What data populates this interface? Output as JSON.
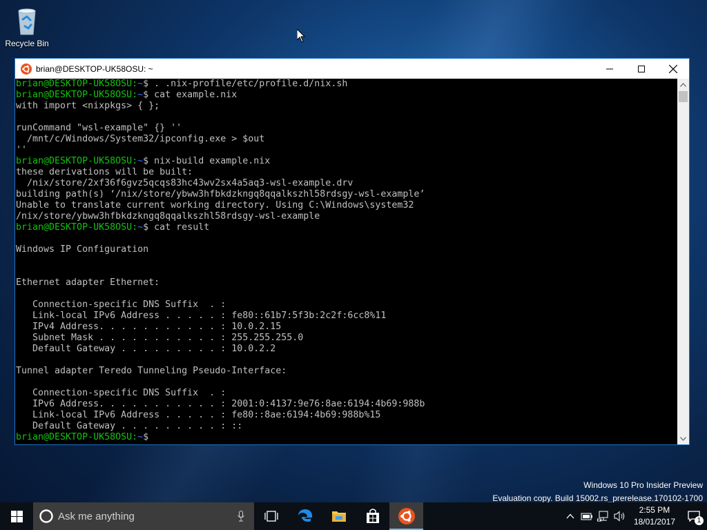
{
  "desktop": {
    "recycle_bin_label": "Recycle Bin"
  },
  "window": {
    "title": "brian@DESKTOP-UK58OSU: ~",
    "minimize_icon": "minimize-icon",
    "maximize_icon": "maximize-icon",
    "close_icon": "close-icon",
    "app_icon": "ubuntu-icon"
  },
  "terminal": {
    "prompt_user": "brian@DESKTOP-UK58OSU:",
    "prompt_path": "~",
    "lines": [
      {
        "prompt": true,
        "cmd": "$ . .nix-profile/etc/profile.d/nix.sh"
      },
      {
        "prompt": true,
        "cmd": "$ cat example.nix"
      },
      {
        "text": "with import <nixpkgs> { };"
      },
      {
        "text": ""
      },
      {
        "text": "runCommand \"wsl-example\" {} ''"
      },
      {
        "text": "  /mnt/c/Windows/System32/ipconfig.exe > $out"
      },
      {
        "text": "''"
      },
      {
        "prompt": true,
        "cmd": "$ nix-build example.nix"
      },
      {
        "text": "these derivations will be built:"
      },
      {
        "text": "  /nix/store/2xf36f6gvz5qcqs83hc43wv2sx4a5aq3-wsl-example.drv"
      },
      {
        "text": "building path(s) ‘/nix/store/ybww3hfbkdzkngq8qqalkszhl58rdsgy-wsl-example’"
      },
      {
        "text": "Unable to translate current working directory. Using C:\\Windows\\system32"
      },
      {
        "text": "/nix/store/ybww3hfbkdzkngq8qqalkszhl58rdsgy-wsl-example"
      },
      {
        "prompt": true,
        "cmd": "$ cat result"
      },
      {
        "text": ""
      },
      {
        "text": "Windows IP Configuration"
      },
      {
        "text": ""
      },
      {
        "text": ""
      },
      {
        "text": "Ethernet adapter Ethernet:"
      },
      {
        "text": ""
      },
      {
        "text": "   Connection-specific DNS Suffix  . :"
      },
      {
        "text": "   Link-local IPv6 Address . . . . . : fe80::61b7:5f3b:2c2f:6cc8%11"
      },
      {
        "text": "   IPv4 Address. . . . . . . . . . . : 10.0.2.15"
      },
      {
        "text": "   Subnet Mask . . . . . . . . . . . : 255.255.255.0"
      },
      {
        "text": "   Default Gateway . . . . . . . . . : 10.0.2.2"
      },
      {
        "text": ""
      },
      {
        "text": "Tunnel adapter Teredo Tunneling Pseudo-Interface:"
      },
      {
        "text": ""
      },
      {
        "text": "   Connection-specific DNS Suffix  . :"
      },
      {
        "text": "   IPv6 Address. . . . . . . . . . . : 2001:0:4137:9e76:8ae:6194:4b69:988b"
      },
      {
        "text": "   Link-local IPv6 Address . . . . . : fe80::8ae:6194:4b69:988b%15"
      },
      {
        "text": "   Default Gateway . . . . . . . . . : ::"
      },
      {
        "prompt": true,
        "cmd": "$ "
      }
    ]
  },
  "watermark": {
    "line1": "Windows 10 Pro Insider Preview",
    "line2": "Evaluation copy. Build 15002.rs_prerelease.170102-1700"
  },
  "taskbar": {
    "search_placeholder": "Ask me anything",
    "clock_time": "2:55 PM",
    "clock_date": "18/01/2017",
    "notification_count": "1",
    "pinned": [
      "task-view-icon",
      "edge-icon",
      "file-explorer-icon",
      "store-icon",
      "ubuntu-icon"
    ]
  },
  "colors": {
    "prompt_user": "#13c30f",
    "prompt_path": "#3b78ff",
    "console_text": "#c0c0c0",
    "window_border": "#1a73c9"
  }
}
